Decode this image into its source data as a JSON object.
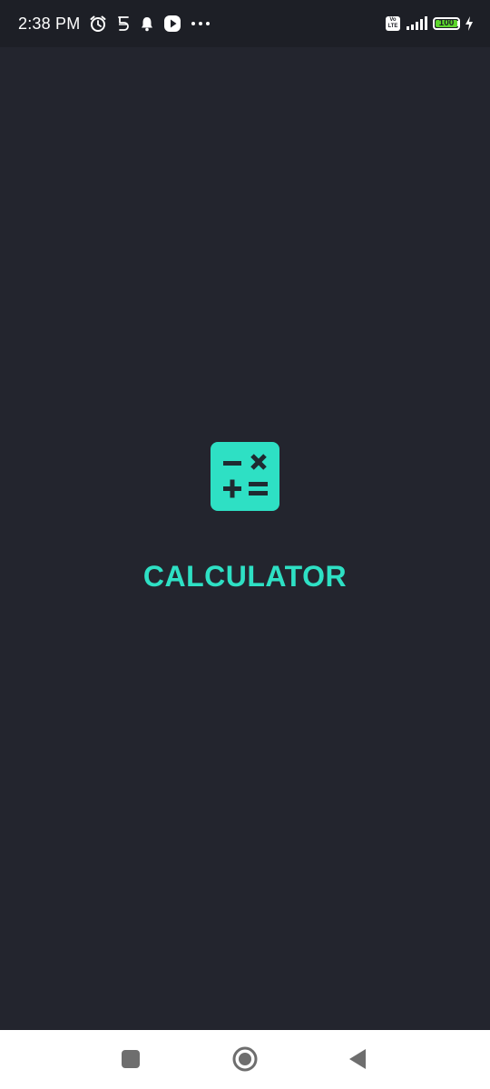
{
  "status_bar": {
    "time": "2:38 PM",
    "icons_left": [
      "alarm-icon",
      "five-icon",
      "notification-bell-icon",
      "play-icon",
      "more-dots-icon"
    ],
    "volte_top": "Vo",
    "volte_bottom": "LTE",
    "battery_level": "100",
    "battery_color": "#5dd62c",
    "icons_right": [
      "volte-icon",
      "signal-icon",
      "battery-icon",
      "charging-icon"
    ]
  },
  "splash": {
    "app_icon": "calculator-icon",
    "title": "CALCULATOR",
    "accent_color": "#2ee0c4",
    "background_color": "#23252e"
  },
  "nav_bar": {
    "buttons": [
      "recents-button",
      "home-button",
      "back-button"
    ]
  }
}
